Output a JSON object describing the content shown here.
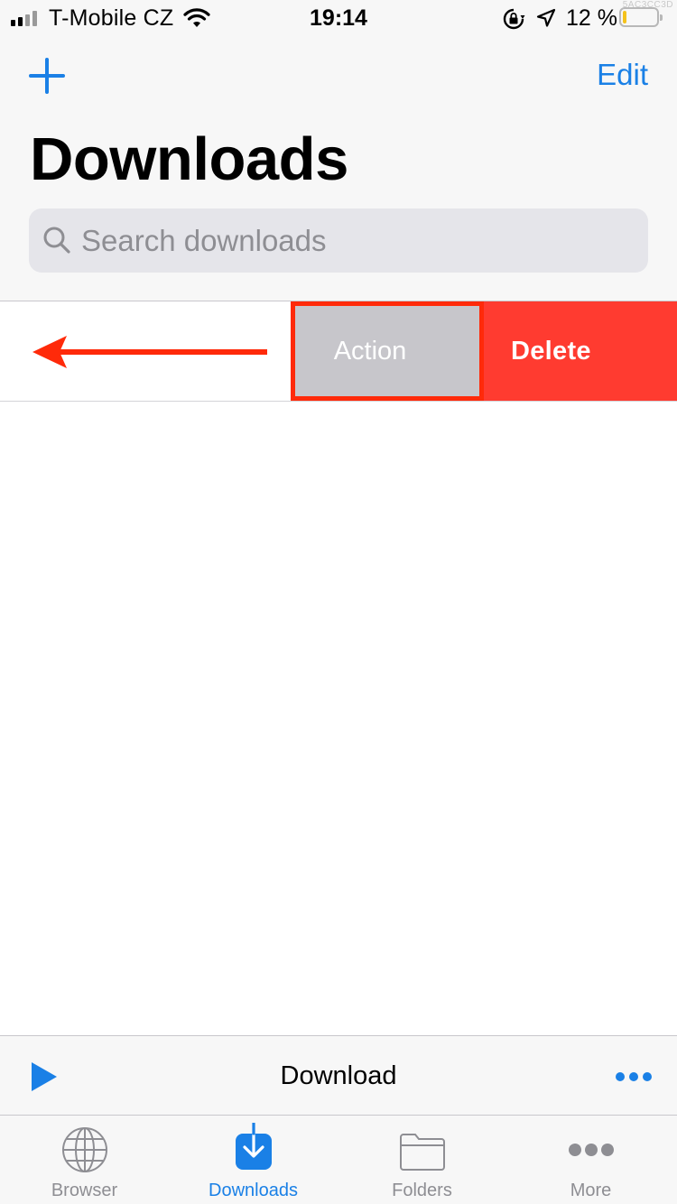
{
  "status_bar": {
    "carrier": "T-Mobile CZ",
    "time": "19:14",
    "battery_percent": "12 %",
    "battery_level": 0.12,
    "watermark": "5AC3CC3D"
  },
  "header": {
    "edit_label": "Edit",
    "title": "Downloads"
  },
  "search": {
    "placeholder": "Search downloads"
  },
  "swipe_row": {
    "action_label": "Action",
    "delete_label": "Delete"
  },
  "player": {
    "title": "Download"
  },
  "tabs": [
    {
      "label": "Browser",
      "icon": "globe-icon",
      "active": false
    },
    {
      "label": "Downloads",
      "icon": "download-icon",
      "active": true
    },
    {
      "label": "Folders",
      "icon": "folder-icon",
      "active": false
    },
    {
      "label": "More",
      "icon": "more-icon",
      "active": false
    }
  ],
  "colors": {
    "accent": "#1a80e6",
    "delete": "#ff3b30",
    "highlight_border": "#ff2a0a",
    "action_bg": "#c7c6cb"
  }
}
